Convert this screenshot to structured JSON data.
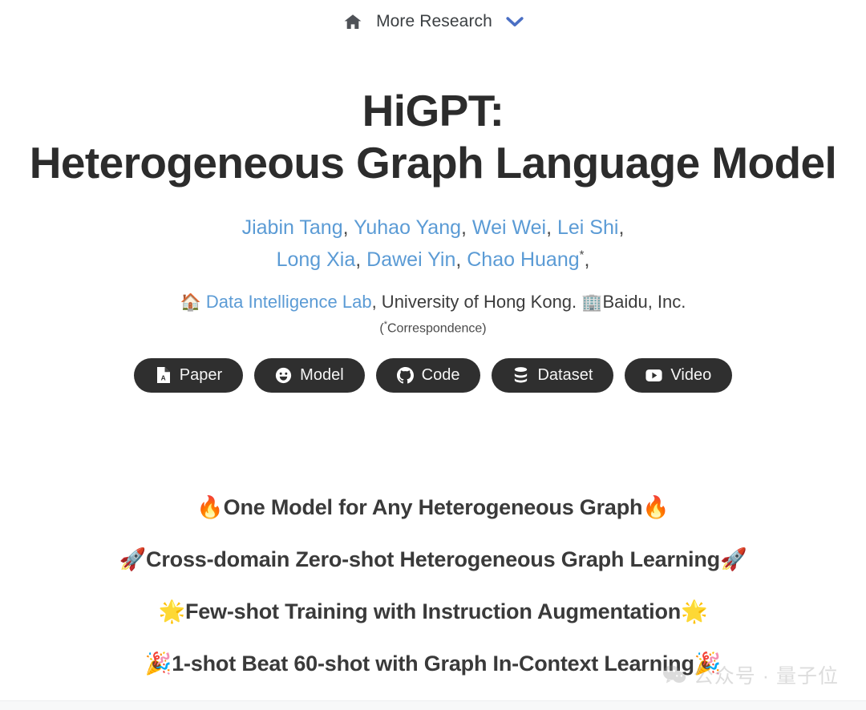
{
  "nav": {
    "home_icon": "home-icon",
    "link_label": "More Research",
    "caret_icon": "chevron-down-icon",
    "caret_color": "#4a6fc4",
    "home_color": "#4f5257"
  },
  "hero": {
    "title_line1": "HiGPT:",
    "title_line2": "Heterogeneous Graph Language Model",
    "authors_row1": [
      {
        "name": "Jiabin Tang",
        "sep": ", "
      },
      {
        "name": "Yuhao Yang",
        "sep": ", "
      },
      {
        "name": "Wei Wei",
        "sep": ", "
      },
      {
        "name": "Lei Shi",
        "sep": ","
      }
    ],
    "authors_row2": [
      {
        "name": "Long Xia",
        "sep": ", "
      },
      {
        "name": "Dawei Yin",
        "sep": ", "
      },
      {
        "name": "Chao Huang",
        "sep": ","
      }
    ],
    "correspondence_marker": "*",
    "link_color": "#5b9bd5",
    "affiliation": {
      "lab_emoji": "🏠",
      "lab_name": "Data Intelligence Lab",
      "university": ", University of Hong Kong.",
      "company_emoji": "🏢",
      "company": "Baidu, Inc."
    },
    "correspondence_note": "Correspondence"
  },
  "buttons": [
    {
      "label": "Paper",
      "icon": "pdf-file-icon"
    },
    {
      "label": "Model",
      "icon": "huggingface-smiley-icon"
    },
    {
      "label": "Code",
      "icon": "github-icon"
    },
    {
      "label": "Dataset",
      "icon": "database-icon"
    },
    {
      "label": "Video",
      "icon": "youtube-play-icon"
    }
  ],
  "button_bg": "#2f2f2f",
  "taglines": [
    {
      "emoji_left": "🔥",
      "text": "One Model for Any Heterogeneous Graph",
      "emoji_right": "🔥"
    },
    {
      "emoji_left": "🚀",
      "text": "Cross-domain Zero-shot Heterogeneous Graph Learning",
      "emoji_right": "🚀"
    },
    {
      "emoji_left": "🌟",
      "text": "Few-shot Training with Instruction Augmentation",
      "emoji_right": "🌟"
    },
    {
      "emoji_left": "🎉",
      "text": "1-shot Beat 60-shot with Graph In-Context Learning",
      "emoji_right": "🎉"
    }
  ],
  "watermark": {
    "icon": "wechat-bubble-icon",
    "text": "公众号 · 量子位",
    "color": "#8e8e8e"
  }
}
